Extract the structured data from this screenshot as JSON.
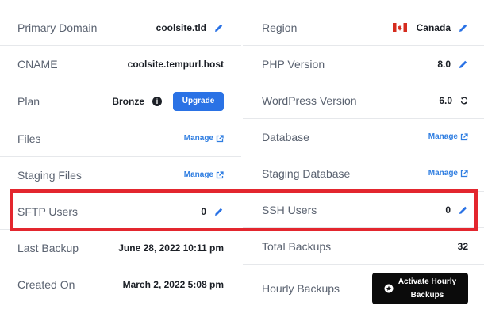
{
  "left": {
    "primary_domain": {
      "label": "Primary Domain",
      "value": "coolsite.tld"
    },
    "cname": {
      "label": "CNAME",
      "value": "coolsite.tempurl.host"
    },
    "plan": {
      "label": "Plan",
      "value": "Bronze",
      "info_symbol": "i",
      "button": "Upgrade"
    },
    "files": {
      "label": "Files",
      "link": "Manage"
    },
    "staging_files": {
      "label": "Staging Files",
      "link": "Manage"
    },
    "sftp_users": {
      "label": "SFTP Users",
      "value": "0"
    },
    "last_backup": {
      "label": "Last Backup",
      "value": "June 28, 2022 10:11 pm"
    },
    "created_on": {
      "label": "Created On",
      "value": "March 2, 2022 5:08 pm"
    }
  },
  "right": {
    "region": {
      "label": "Region",
      "value": "Canada",
      "flag_icon": "canada-flag-icon"
    },
    "php_version": {
      "label": "PHP Version",
      "value": "8.0"
    },
    "wordpress_version": {
      "label": "WordPress Version",
      "value": "6.0"
    },
    "database": {
      "label": "Database",
      "link": "Manage"
    },
    "staging_database": {
      "label": "Staging Database",
      "link": "Manage"
    },
    "ssh_users": {
      "label": "SSH Users",
      "value": "0"
    },
    "total_backups": {
      "label": "Total Backups",
      "value": "32"
    },
    "hourly_backups": {
      "label": "Hourly Backups",
      "button_line1": "Activate Hourly",
      "button_line2": "Backups"
    }
  },
  "colors": {
    "accent": "#2a72e5",
    "link": "#2e7de1",
    "highlight": "#e3262e",
    "text": "#1b1f26",
    "label": "#5a6270"
  }
}
